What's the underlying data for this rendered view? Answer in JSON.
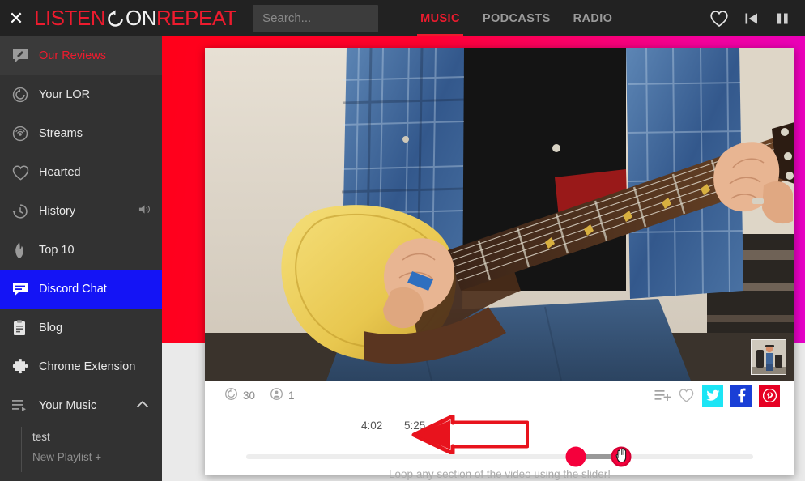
{
  "brand": {
    "close_label": "✕",
    "word1": "LISTEN",
    "word2": "ON",
    "word3": "REPEAT",
    "loop_icon": "loop-icon",
    "red": "#ed1b2e",
    "white": "#f2f2f2"
  },
  "search": {
    "placeholder": "Search...",
    "value": "",
    "icon": "search-input"
  },
  "nav": {
    "tabs": [
      {
        "label": "MUSIC",
        "active": true
      },
      {
        "label": "PODCASTS",
        "active": false
      },
      {
        "label": "RADIO",
        "active": false
      }
    ]
  },
  "top_right": {
    "icons": [
      {
        "name": "heart-icon"
      },
      {
        "name": "previous-track-icon"
      },
      {
        "name": "pause-icon"
      }
    ]
  },
  "sidebar": {
    "items": [
      {
        "label": "Our Reviews",
        "icon": "review-bubble-icon",
        "state": "reviews"
      },
      {
        "label": "Your LOR",
        "icon": "loop-circle-icon",
        "state": "normal"
      },
      {
        "label": "Streams",
        "icon": "broadcast-icon",
        "state": "normal"
      },
      {
        "label": "Hearted",
        "icon": "heart-icon",
        "state": "normal"
      },
      {
        "label": "History",
        "icon": "history-clock-icon",
        "state": "normal",
        "trailing_icon": "volume-icon"
      },
      {
        "label": "Top 10",
        "icon": "flame-icon",
        "state": "normal"
      },
      {
        "label": "Discord Chat",
        "icon": "chat-bubble-icon",
        "state": "discord"
      },
      {
        "label": "Blog",
        "icon": "clipboard-icon",
        "state": "normal"
      },
      {
        "label": "Chrome Extension",
        "icon": "puzzle-piece-icon",
        "state": "normal"
      },
      {
        "label": "Your Music",
        "icon": "playlist-icon",
        "state": "normal",
        "trailing_icon": "chevron-up-icon"
      }
    ],
    "playlists": [
      {
        "label": "test",
        "muted": false
      },
      {
        "label": "New Playlist +",
        "muted": true
      }
    ]
  },
  "player": {
    "stats": [
      {
        "icon": "repeat-count-icon",
        "value": "30"
      },
      {
        "icon": "listener-count-icon",
        "value": "1"
      }
    ],
    "share": [
      {
        "name": "add-to-playlist-icon",
        "type": "plain"
      },
      {
        "name": "heart-icon",
        "type": "plain"
      },
      {
        "name": "twitter-icon",
        "type": "square",
        "color": "#1ce5f5"
      },
      {
        "name": "facebook-icon",
        "type": "square",
        "color": "#1a3fd6"
      },
      {
        "name": "pinterest-icon",
        "type": "square",
        "color": "#e60023"
      }
    ],
    "loop_start_time": "4:02",
    "loop_end_time": "5:25",
    "hint": "Loop any section of the video using the slider!",
    "handle_color": "#f5003c",
    "track_color": "#ededed",
    "selection_color": "#999999",
    "start_pct": 65,
    "end_pct": 74,
    "cursor_icon": "hand-cursor-icon",
    "annotation_icon": "red-arrow-annotation"
  },
  "video": {
    "mini_thumb_name": "channel-thumbnail",
    "content_description": "guitar-player-video-frame"
  },
  "colors": {
    "topbar_bg": "#222222",
    "sidebar_bg": "#323232",
    "accent_red": "#ed1b2e",
    "discord_blue": "#1414f5",
    "page_bg": "#eaeaea",
    "stage_red": "#ff0019",
    "stage_magenta": "#e400c8"
  }
}
